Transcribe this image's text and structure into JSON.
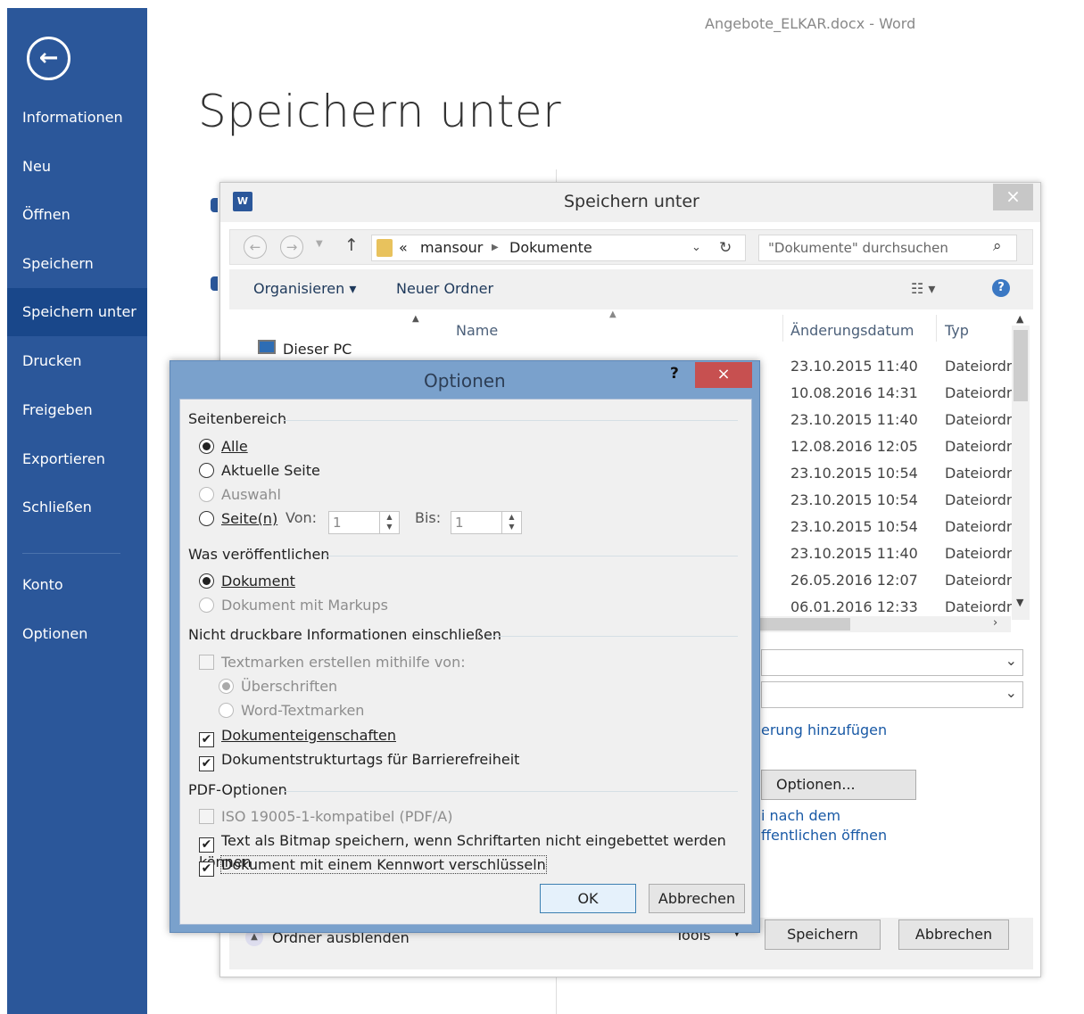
{
  "app": {
    "window_title": "Angebote_ELKAR.docx - Word",
    "page_title": "Speichern unter"
  },
  "sidebar": {
    "back_icon": "back-arrow-icon",
    "items": [
      {
        "label": "Informationen"
      },
      {
        "label": "Neu"
      },
      {
        "label": "Öffnen"
      },
      {
        "label": "Speichern"
      },
      {
        "label": "Speichern unter",
        "active": true
      },
      {
        "label": "Drucken"
      },
      {
        "label": "Freigeben"
      },
      {
        "label": "Exportieren"
      },
      {
        "label": "Schließen"
      },
      {
        "label": "Konto"
      },
      {
        "label": "Optionen"
      }
    ],
    "color": "#2b579a"
  },
  "saveas": {
    "title": "Speichern unter",
    "close": "×",
    "breadcrumb": {
      "prefix": "«",
      "parts": [
        "mansour",
        "Dokumente"
      ]
    },
    "search_placeholder": "\"Dokumente\" durchsuchen",
    "organize": "Organisieren ▾",
    "new_folder": "Neuer Ordner",
    "left_pane": {
      "item": "Dieser PC"
    },
    "columns": {
      "name": "Name",
      "date": "Änderungsdatum",
      "type": "Typ"
    },
    "rows": [
      {
        "date": "23.10.2015 11:40",
        "type": "Dateiordr"
      },
      {
        "date": "10.08.2016 14:31",
        "type": "Dateiordr"
      },
      {
        "date": "23.10.2015 11:40",
        "type": "Dateiordr"
      },
      {
        "date": "12.08.2016 12:05",
        "type": "Dateiordr"
      },
      {
        "date": "23.10.2015 10:54",
        "type": "Dateiordr"
      },
      {
        "date": "23.10.2015 10:54",
        "type": "Dateiordr"
      },
      {
        "date": "23.10.2015 10:54",
        "type": "Dateiordr"
      },
      {
        "date": "23.10.2015 11:40",
        "type": "Dateiordr"
      },
      {
        "date": "26.05.2016 12:07",
        "type": "Dateiordr"
      },
      {
        "date": "06.01.2016 12:33",
        "type": "Dateiordr"
      }
    ],
    "link_tag": "erung hinzufügen",
    "options_button": "Optionen...",
    "publish_link_1": "i nach dem",
    "publish_link_2": "ffentlichen öffnen",
    "hide_folders": "Ordner ausblenden",
    "tools": "Tools",
    "save_button": "Speichern",
    "cancel_button": "Abbrechen"
  },
  "options": {
    "title": "Optionen",
    "help": "?",
    "close": "×",
    "page_range": {
      "label": "Seitenbereich",
      "all": "Alle",
      "current": "Aktuelle Seite",
      "selection": "Auswahl",
      "pages": "Seite(n)",
      "from_label": "Von:",
      "from_value": "1",
      "to_label": "Bis:",
      "to_value": "1"
    },
    "publish": {
      "label": "Was veröffentlichen",
      "document": "Dokument",
      "document_markup": "Dokument mit Markups"
    },
    "nonprint": {
      "label": "Nicht druckbare Informationen einschließen",
      "bookmarks": "Textmarken erstellen mithilfe von:",
      "headings": "Überschriften",
      "word_bookmarks": "Word-Textmarken",
      "doc_props": "Dokumenteigenschaften",
      "struct_tags": "Dokumentstrukturtags für Barrierefreiheit"
    },
    "pdf": {
      "label": "PDF-Optionen",
      "iso": "ISO 19005-1-kompatibel (PDF/A)",
      "bitmap": "Text als Bitmap speichern, wenn Schriftarten nicht eingebettet werden können",
      "encrypt": "Dokument mit einem Kennwort verschlüsseln"
    },
    "ok": "OK",
    "cancel": "Abbrechen"
  }
}
